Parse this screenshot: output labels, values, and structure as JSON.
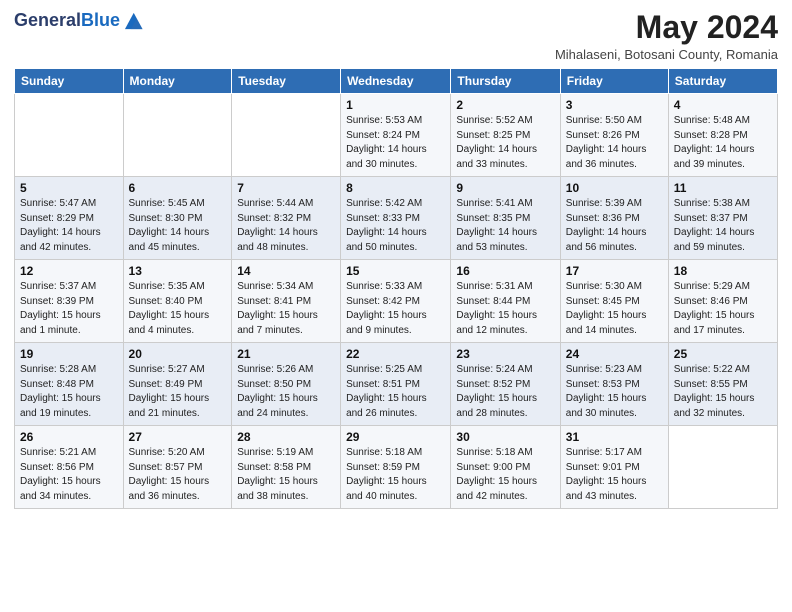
{
  "header": {
    "logo_general": "General",
    "logo_blue": "Blue",
    "month": "May 2024",
    "location": "Mihalaseni, Botosani County, Romania"
  },
  "weekdays": [
    "Sunday",
    "Monday",
    "Tuesday",
    "Wednesday",
    "Thursday",
    "Friday",
    "Saturday"
  ],
  "weeks": [
    [
      {
        "day": "",
        "sunrise": "",
        "sunset": "",
        "daylight": ""
      },
      {
        "day": "",
        "sunrise": "",
        "sunset": "",
        "daylight": ""
      },
      {
        "day": "",
        "sunrise": "",
        "sunset": "",
        "daylight": ""
      },
      {
        "day": "1",
        "sunrise": "Sunrise: 5:53 AM",
        "sunset": "Sunset: 8:24 PM",
        "daylight": "Daylight: 14 hours and 30 minutes."
      },
      {
        "day": "2",
        "sunrise": "Sunrise: 5:52 AM",
        "sunset": "Sunset: 8:25 PM",
        "daylight": "Daylight: 14 hours and 33 minutes."
      },
      {
        "day": "3",
        "sunrise": "Sunrise: 5:50 AM",
        "sunset": "Sunset: 8:26 PM",
        "daylight": "Daylight: 14 hours and 36 minutes."
      },
      {
        "day": "4",
        "sunrise": "Sunrise: 5:48 AM",
        "sunset": "Sunset: 8:28 PM",
        "daylight": "Daylight: 14 hours and 39 minutes."
      }
    ],
    [
      {
        "day": "5",
        "sunrise": "Sunrise: 5:47 AM",
        "sunset": "Sunset: 8:29 PM",
        "daylight": "Daylight: 14 hours and 42 minutes."
      },
      {
        "day": "6",
        "sunrise": "Sunrise: 5:45 AM",
        "sunset": "Sunset: 8:30 PM",
        "daylight": "Daylight: 14 hours and 45 minutes."
      },
      {
        "day": "7",
        "sunrise": "Sunrise: 5:44 AM",
        "sunset": "Sunset: 8:32 PM",
        "daylight": "Daylight: 14 hours and 48 minutes."
      },
      {
        "day": "8",
        "sunrise": "Sunrise: 5:42 AM",
        "sunset": "Sunset: 8:33 PM",
        "daylight": "Daylight: 14 hours and 50 minutes."
      },
      {
        "day": "9",
        "sunrise": "Sunrise: 5:41 AM",
        "sunset": "Sunset: 8:35 PM",
        "daylight": "Daylight: 14 hours and 53 minutes."
      },
      {
        "day": "10",
        "sunrise": "Sunrise: 5:39 AM",
        "sunset": "Sunset: 8:36 PM",
        "daylight": "Daylight: 14 hours and 56 minutes."
      },
      {
        "day": "11",
        "sunrise": "Sunrise: 5:38 AM",
        "sunset": "Sunset: 8:37 PM",
        "daylight": "Daylight: 14 hours and 59 minutes."
      }
    ],
    [
      {
        "day": "12",
        "sunrise": "Sunrise: 5:37 AM",
        "sunset": "Sunset: 8:39 PM",
        "daylight": "Daylight: 15 hours and 1 minute."
      },
      {
        "day": "13",
        "sunrise": "Sunrise: 5:35 AM",
        "sunset": "Sunset: 8:40 PM",
        "daylight": "Daylight: 15 hours and 4 minutes."
      },
      {
        "day": "14",
        "sunrise": "Sunrise: 5:34 AM",
        "sunset": "Sunset: 8:41 PM",
        "daylight": "Daylight: 15 hours and 7 minutes."
      },
      {
        "day": "15",
        "sunrise": "Sunrise: 5:33 AM",
        "sunset": "Sunset: 8:42 PM",
        "daylight": "Daylight: 15 hours and 9 minutes."
      },
      {
        "day": "16",
        "sunrise": "Sunrise: 5:31 AM",
        "sunset": "Sunset: 8:44 PM",
        "daylight": "Daylight: 15 hours and 12 minutes."
      },
      {
        "day": "17",
        "sunrise": "Sunrise: 5:30 AM",
        "sunset": "Sunset: 8:45 PM",
        "daylight": "Daylight: 15 hours and 14 minutes."
      },
      {
        "day": "18",
        "sunrise": "Sunrise: 5:29 AM",
        "sunset": "Sunset: 8:46 PM",
        "daylight": "Daylight: 15 hours and 17 minutes."
      }
    ],
    [
      {
        "day": "19",
        "sunrise": "Sunrise: 5:28 AM",
        "sunset": "Sunset: 8:48 PM",
        "daylight": "Daylight: 15 hours and 19 minutes."
      },
      {
        "day": "20",
        "sunrise": "Sunrise: 5:27 AM",
        "sunset": "Sunset: 8:49 PM",
        "daylight": "Daylight: 15 hours and 21 minutes."
      },
      {
        "day": "21",
        "sunrise": "Sunrise: 5:26 AM",
        "sunset": "Sunset: 8:50 PM",
        "daylight": "Daylight: 15 hours and 24 minutes."
      },
      {
        "day": "22",
        "sunrise": "Sunrise: 5:25 AM",
        "sunset": "Sunset: 8:51 PM",
        "daylight": "Daylight: 15 hours and 26 minutes."
      },
      {
        "day": "23",
        "sunrise": "Sunrise: 5:24 AM",
        "sunset": "Sunset: 8:52 PM",
        "daylight": "Daylight: 15 hours and 28 minutes."
      },
      {
        "day": "24",
        "sunrise": "Sunrise: 5:23 AM",
        "sunset": "Sunset: 8:53 PM",
        "daylight": "Daylight: 15 hours and 30 minutes."
      },
      {
        "day": "25",
        "sunrise": "Sunrise: 5:22 AM",
        "sunset": "Sunset: 8:55 PM",
        "daylight": "Daylight: 15 hours and 32 minutes."
      }
    ],
    [
      {
        "day": "26",
        "sunrise": "Sunrise: 5:21 AM",
        "sunset": "Sunset: 8:56 PM",
        "daylight": "Daylight: 15 hours and 34 minutes."
      },
      {
        "day": "27",
        "sunrise": "Sunrise: 5:20 AM",
        "sunset": "Sunset: 8:57 PM",
        "daylight": "Daylight: 15 hours and 36 minutes."
      },
      {
        "day": "28",
        "sunrise": "Sunrise: 5:19 AM",
        "sunset": "Sunset: 8:58 PM",
        "daylight": "Daylight: 15 hours and 38 minutes."
      },
      {
        "day": "29",
        "sunrise": "Sunrise: 5:18 AM",
        "sunset": "Sunset: 8:59 PM",
        "daylight": "Daylight: 15 hours and 40 minutes."
      },
      {
        "day": "30",
        "sunrise": "Sunrise: 5:18 AM",
        "sunset": "Sunset: 9:00 PM",
        "daylight": "Daylight: 15 hours and 42 minutes."
      },
      {
        "day": "31",
        "sunrise": "Sunrise: 5:17 AM",
        "sunset": "Sunset: 9:01 PM",
        "daylight": "Daylight: 15 hours and 43 minutes."
      },
      {
        "day": "",
        "sunrise": "",
        "sunset": "",
        "daylight": ""
      }
    ]
  ]
}
